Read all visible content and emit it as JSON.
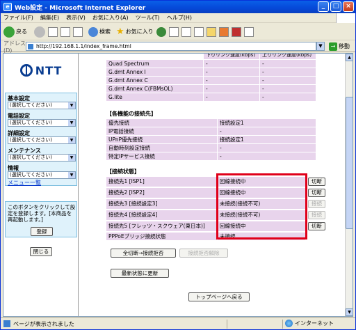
{
  "window": {
    "title": "Web設定 - Microsoft Internet Explorer",
    "min": "_",
    "max": "□",
    "close": "×"
  },
  "menubar": [
    "ファイル(F)",
    "編集(E)",
    "表示(V)",
    "お気に入り(A)",
    "ツール(T)",
    "ヘルプ(H)"
  ],
  "toolbar": {
    "back": "戻る",
    "search": "検索",
    "favorites": "お気に入り"
  },
  "address": {
    "label": "アドレス(D)",
    "url": "http://192.168.1.1/index_frame.html",
    "go": "移動"
  },
  "left": {
    "logo": "NTT",
    "sections": [
      {
        "label": "基本設定",
        "value": "(選択してください)"
      },
      {
        "label": "電話設定",
        "value": "(選択してください)"
      },
      {
        "label": "詳細設定",
        "value": "(選択してください)"
      },
      {
        "label": "メンテナンス",
        "value": "(選択してください)"
      },
      {
        "label": "情報",
        "value": "(選択してください)"
      }
    ],
    "menu_list": "メニュー一覧",
    "note": "このボタンをクリックして設定を登録します。[本商品を再起動します。]",
    "register": "登録",
    "close": "閉じる"
  },
  "right": {
    "header_down": "下りリンク速度(kbps)",
    "header_up": "上りリンク速度(kbps)",
    "speed_rows": [
      {
        "label": "Quad Spectrum",
        "down": "-",
        "up": "-"
      },
      {
        "label": "G.dmt Annex I",
        "down": "-",
        "up": "-"
      },
      {
        "label": "G.dmt Annex C",
        "down": "-",
        "up": "-"
      },
      {
        "label": "G.dmt Annex C(FBMsOL)",
        "down": "-",
        "up": "-"
      },
      {
        "label": "G.lite",
        "down": "-",
        "up": "-"
      }
    ],
    "dest_title": "【各機能の接続先】",
    "dest_rows": [
      {
        "label": "優先接続",
        "value": "接続設定1"
      },
      {
        "label": "IP電話接続",
        "value": "-"
      },
      {
        "label": "UPnP優先接続",
        "value": "接続設定1"
      },
      {
        "label": "自動時刻設定接続",
        "value": "-"
      },
      {
        "label": "特定IPサービス接続",
        "value": "-"
      }
    ],
    "status_title": "【接続状態】",
    "status_rows": [
      {
        "label": "接続先1 [ISP1]",
        "value": "回線接続中",
        "button": "切断",
        "enabled": true
      },
      {
        "label": "接続先2 [ISP2]",
        "value": "回線接続中",
        "button": "切断",
        "enabled": true
      },
      {
        "label": "接続先3 [接続設定3]",
        "value": "未接続(接続不可)",
        "button": "接続",
        "enabled": false
      },
      {
        "label": "接続先4 [接続設定4]",
        "value": "未接続(接続不可)",
        "button": "接続",
        "enabled": false
      },
      {
        "label": "接続先5 [フレッツ・スクウェア(東日本)]",
        "value": "回線接続中",
        "button": "切断",
        "enabled": true
      },
      {
        "label": "PPPoEブリッジ接続状態",
        "value": "未接続",
        "button": "",
        "enabled": false
      }
    ],
    "all_disconnect": "全切断→接続拒否",
    "release_reject": "接続拒否解除",
    "refresh": "最新状態に更新",
    "top_back": "トップページへ戻る"
  },
  "statusbar": {
    "text": "ページが表示されました",
    "zone": "インターネット"
  }
}
